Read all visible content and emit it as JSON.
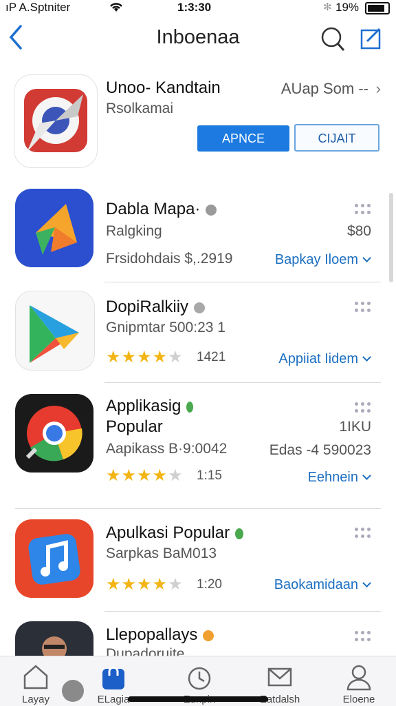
{
  "status": {
    "carrier": "ıP A.Sptniter",
    "time": "1:3:30",
    "battery": "19%"
  },
  "nav": {
    "title": "Inboenaa"
  },
  "featured": {
    "title": "Unoo- Kandtain",
    "subtitle": "Rsolkamai",
    "right_link": "AUap Som --",
    "btn_primary": "APNCE",
    "btn_secondary": "CIJAIT"
  },
  "apps": [
    {
      "title": "Dabla Mapa·",
      "category": "Ralgking",
      "price": "$80",
      "info": "Frsidohdais $,.2919",
      "action": "Bapkay Iloem"
    },
    {
      "title": "DopiRalkiiy",
      "info": "Gnipmtar 500:23 1",
      "rating_count": "1421",
      "action": "Appiiat Iidem"
    },
    {
      "title": "Applikasig",
      "title2": "Popular",
      "price": "1IKU",
      "info": "Aapikass B·9:0042",
      "info_right": "Edas -4 590023",
      "rating_count": "1:15",
      "action": "Eehnein"
    },
    {
      "title": "Apulkasi Popular",
      "info": "Sarpkas BaM013",
      "rating_count": "1:20",
      "action": "Baokamidaan"
    },
    {
      "title": "Llepopallays",
      "info": "Dupadoruite"
    }
  ],
  "stars": {
    "rating": 4.5,
    "text": "★★★★",
    "half": "★"
  },
  "tabs": [
    {
      "label": "Layay"
    },
    {
      "label": "ELagia"
    },
    {
      "label": "Eunpin"
    },
    {
      "label": "Eatdalsh"
    },
    {
      "label": "Eloene"
    }
  ],
  "colors": {
    "accent": "#1c7ae0",
    "star": "#f2b515"
  }
}
